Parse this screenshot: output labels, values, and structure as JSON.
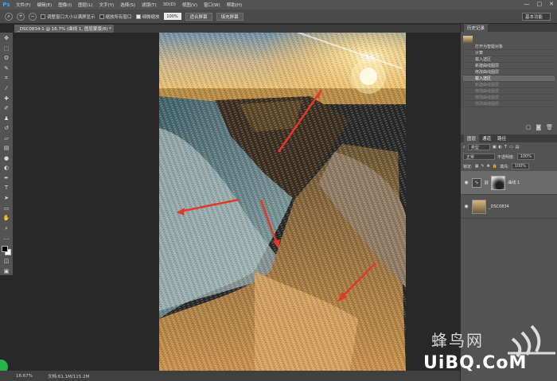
{
  "app": {
    "logo": "Ps"
  },
  "menu": {
    "items": [
      "文件(F)",
      "编辑(E)",
      "图像(I)",
      "图层(L)",
      "文字(Y)",
      "选择(S)",
      "滤镜(T)",
      "3D(D)",
      "视图(V)",
      "窗口(W)",
      "帮助(H)"
    ]
  },
  "window": {
    "minimize": "—",
    "maximize": "□",
    "close": "✕"
  },
  "options": {
    "resize_label": "调整窗口大小以满屏显示",
    "zoom_all_label": "缩放所有窗口",
    "scrubby_label": "细微缩放",
    "zoom_value": "100%",
    "fit_button": "适合屏幕",
    "fill_button": "填充屏幕",
    "workspace": "基本功能"
  },
  "document": {
    "tab_title": "_DSC0834-1 @ 16.7% (曲线 1, 图层蒙版/8) *",
    "close": "×"
  },
  "status": {
    "zoom": "16.67%",
    "doc_info": "文档:61.1M/115.2M"
  },
  "history": {
    "tab": "历史记录",
    "snapshot": "",
    "items": [
      {
        "label": "打开为智能对象",
        "state": "normal"
      },
      {
        "label": "计算",
        "state": "normal"
      },
      {
        "label": "载入选区",
        "state": "normal"
      },
      {
        "label": "新建曲线图层",
        "state": "normal"
      },
      {
        "label": "修改曲线图层",
        "state": "normal"
      },
      {
        "label": "载入选区",
        "state": "active"
      },
      {
        "label": "新建曲线图层",
        "state": "dim"
      },
      {
        "label": "修改曲线图层",
        "state": "dim"
      },
      {
        "label": "修改曲线图层",
        "state": "dim"
      },
      {
        "label": "修改曲线图层",
        "state": "dim"
      }
    ]
  },
  "layers": {
    "tabs": [
      "图层",
      "通道",
      "路径"
    ],
    "filter": "类型",
    "blend_mode": "正常",
    "opacity_label": "不透明度:",
    "opacity_value": "100%",
    "lock_label": "锁定:",
    "fill_label": "填充:",
    "fill_value": "100%",
    "items": [
      {
        "name": "曲线 1",
        "active": true
      },
      {
        "name": "_DSC0834",
        "active": false
      }
    ]
  },
  "watermark": {
    "cn": "蜂鸟网",
    "en": "UiBQ.CoM"
  }
}
